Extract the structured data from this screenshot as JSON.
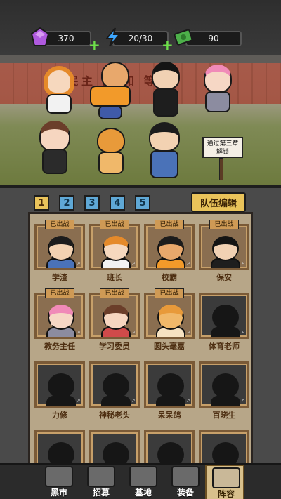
{
  "resources": [
    {
      "name": "gem",
      "value": "370",
      "color": "#b05adf",
      "icon": "purple-gem-icon"
    },
    {
      "name": "energy",
      "value": "20/30",
      "color": "#3da7ff",
      "icon": "lightning-icon"
    },
    {
      "name": "cash",
      "value": "90",
      "color": "#4db04a",
      "icon": "banknote-icon"
    }
  ],
  "scene": {
    "sign_text": "民主 团 和 等",
    "post_line1": "通过第三章",
    "post_line2": "解锁"
  },
  "tabs": [
    "1",
    "2",
    "3",
    "4",
    "5"
  ],
  "team_edit_label": "队伍编辑",
  "cards": [
    {
      "name": "学渣",
      "badge": "已出战",
      "locked": false,
      "hair": "#1c1c1c",
      "skin": "#f3d2b2",
      "shirt": "#4a72b8"
    },
    {
      "name": "班长",
      "badge": "已出战",
      "locked": false,
      "hair": "#e58a2a",
      "skin": "#f6d8be",
      "shirt": "#f2f2f2"
    },
    {
      "name": "校霸",
      "badge": "已出战",
      "locked": false,
      "hair": "#1c1c1c",
      "skin": "#e8a86c",
      "shirt": "#f29a2a"
    },
    {
      "name": "保安",
      "badge": "已出战",
      "locked": false,
      "hair": "#141414",
      "skin": "#f1d1b3",
      "shirt": "#1e1e1e"
    },
    {
      "name": "教务主任",
      "badge": "已出战",
      "locked": false,
      "hair": "#f08ab8",
      "skin": "#f6d7c5",
      "shirt": "#8c8ca0"
    },
    {
      "name": "学习委员",
      "badge": "已出战",
      "locked": false,
      "hair": "#6b3e2a",
      "skin": "#f6d6c0",
      "shirt": "#d04a4a"
    },
    {
      "name": "圆头毫嘉",
      "badge": "已出战",
      "locked": false,
      "hair": "#e89a3a",
      "skin": "#f0b86a",
      "shirt": "#f6e2c2"
    },
    {
      "name": "体育老师",
      "badge": "",
      "locked": true
    },
    {
      "name": "力修",
      "badge": "",
      "locked": true
    },
    {
      "name": "神秘老头",
      "badge": "",
      "locked": true
    },
    {
      "name": "呆呆鸽",
      "badge": "",
      "locked": true
    },
    {
      "name": "百晓生",
      "badge": "",
      "locked": true
    },
    {
      "name": "",
      "badge": "",
      "locked": true
    },
    {
      "name": "",
      "badge": "",
      "locked": true
    },
    {
      "name": "",
      "badge": "",
      "locked": true
    },
    {
      "name": "",
      "badge": "",
      "locked": true
    }
  ],
  "nav": [
    {
      "label": "黑市",
      "icon": "sack-icon",
      "active": false
    },
    {
      "label": "招募",
      "icon": "cards-icon",
      "active": false
    },
    {
      "label": "基地",
      "icon": "building-icon",
      "active": false
    },
    {
      "label": "装备",
      "icon": "equipment-icon",
      "active": false
    },
    {
      "label": "阵容",
      "icon": "lineup-icon",
      "active": true
    }
  ]
}
